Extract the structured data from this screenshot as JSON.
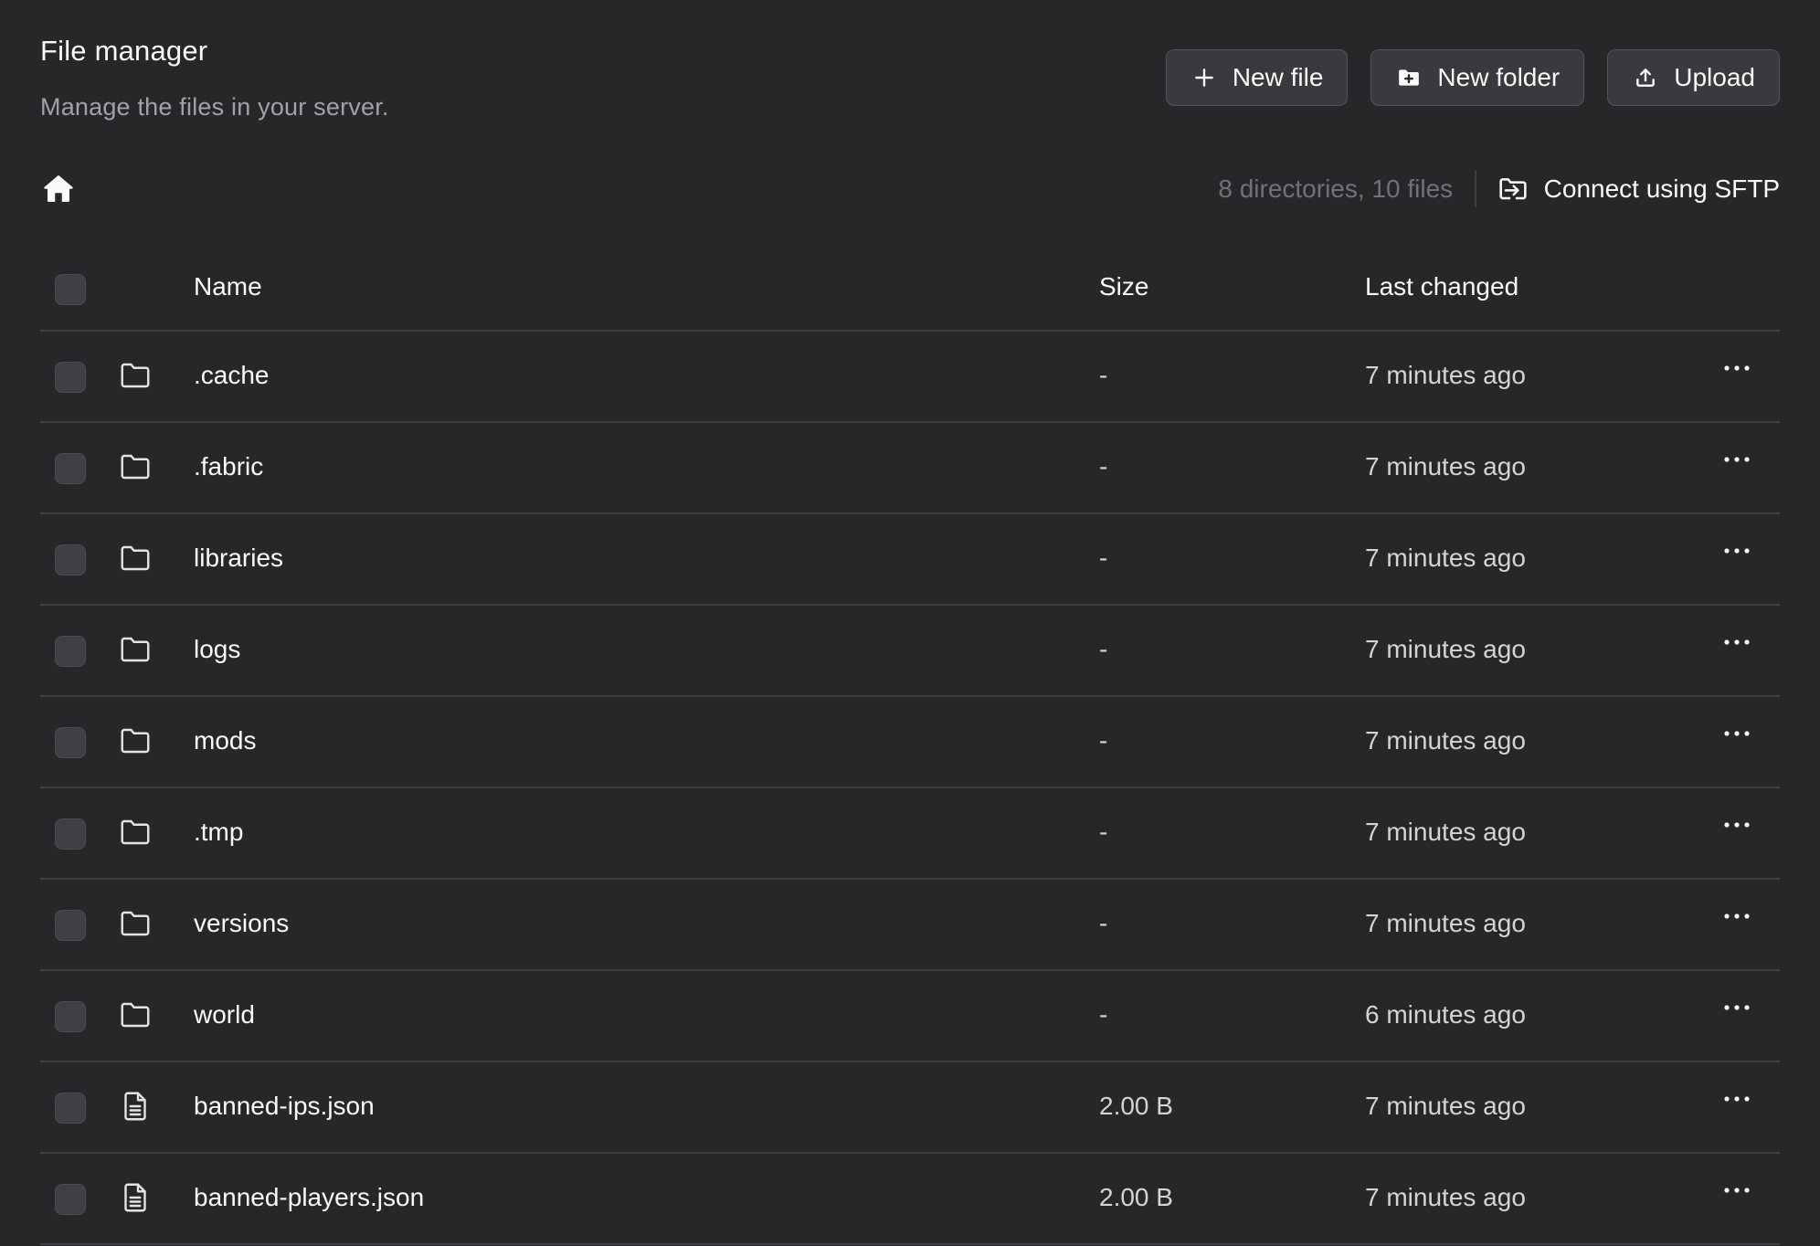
{
  "header": {
    "title": "File manager",
    "subtitle": "Manage the files in your server."
  },
  "actions": {
    "new_file": "New file",
    "new_folder": "New folder",
    "upload": "Upload"
  },
  "toolbar": {
    "count": "8 directories, 10 files",
    "sftp_label": "Connect using SFTP",
    "home_icon": "home-icon"
  },
  "table": {
    "columns": {
      "name": "Name",
      "size": "Size",
      "changed": "Last changed"
    },
    "rows": [
      {
        "type": "folder",
        "name": ".cache",
        "size": "-",
        "changed": "7 minutes ago"
      },
      {
        "type": "folder",
        "name": ".fabric",
        "size": "-",
        "changed": "7 minutes ago"
      },
      {
        "type": "folder",
        "name": "libraries",
        "size": "-",
        "changed": "7 minutes ago"
      },
      {
        "type": "folder",
        "name": "logs",
        "size": "-",
        "changed": "7 minutes ago"
      },
      {
        "type": "folder",
        "name": "mods",
        "size": "-",
        "changed": "7 minutes ago"
      },
      {
        "type": "folder",
        "name": ".tmp",
        "size": "-",
        "changed": "7 minutes ago"
      },
      {
        "type": "folder",
        "name": "versions",
        "size": "-",
        "changed": "7 minutes ago"
      },
      {
        "type": "folder",
        "name": "world",
        "size": "-",
        "changed": "6 minutes ago"
      },
      {
        "type": "file",
        "name": "banned-ips.json",
        "size": "2.00 B",
        "changed": "7 minutes ago"
      },
      {
        "type": "file",
        "name": "banned-players.json",
        "size": "2.00 B",
        "changed": "7 minutes ago"
      }
    ]
  },
  "colors": {
    "background": "#27272a",
    "border": "#3f3f46",
    "text": "#fafafa",
    "muted": "#a1a1aa"
  }
}
